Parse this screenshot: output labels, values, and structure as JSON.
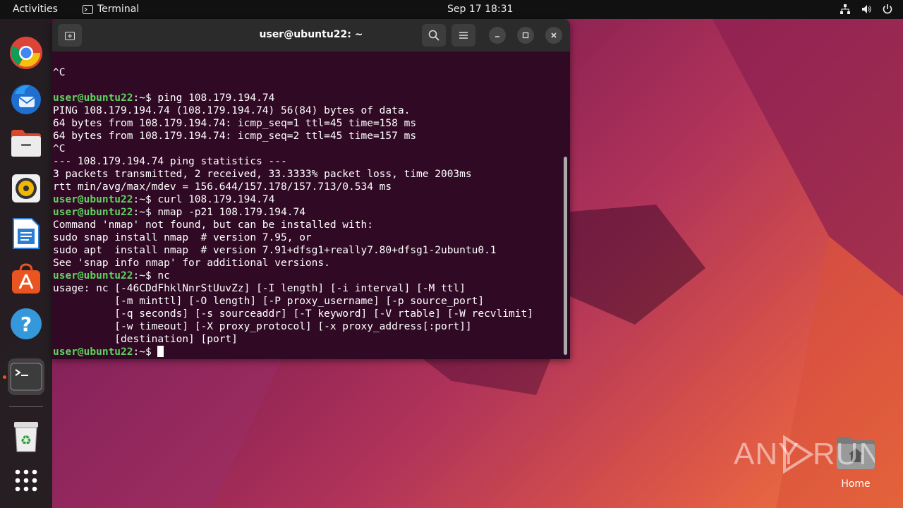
{
  "topbar": {
    "activities": "Activities",
    "app_name": "Terminal",
    "clock": "Sep 17  18:31"
  },
  "dock": {
    "items": [
      "chrome-icon",
      "thunderbird-icon",
      "files-icon",
      "rhythmbox-icon",
      "libreoffice-writer-icon",
      "app-center-icon",
      "help-icon",
      "terminal-icon",
      "trash-icon",
      "show-apps-icon"
    ]
  },
  "terminal": {
    "title": "user@ubuntu22: ~",
    "prompt_user": "user@ubuntu22",
    "prompt_suffix": ":~$",
    "lines": [
      {
        "type": "out",
        "text": "^C"
      },
      {
        "type": "out",
        "text": ""
      },
      {
        "type": "cmd",
        "text": " ping 108.179.194.74"
      },
      {
        "type": "out",
        "text": "PING 108.179.194.74 (108.179.194.74) 56(84) bytes of data."
      },
      {
        "type": "out",
        "text": "64 bytes from 108.179.194.74: icmp_seq=1 ttl=45 time=158 ms"
      },
      {
        "type": "out",
        "text": "64 bytes from 108.179.194.74: icmp_seq=2 ttl=45 time=157 ms"
      },
      {
        "type": "out",
        "text": "^C"
      },
      {
        "type": "out",
        "text": "--- 108.179.194.74 ping statistics ---"
      },
      {
        "type": "out",
        "text": "3 packets transmitted, 2 received, 33.3333% packet loss, time 2003ms"
      },
      {
        "type": "out",
        "text": "rtt min/avg/max/mdev = 156.644/157.178/157.713/0.534 ms"
      },
      {
        "type": "cmd",
        "text": " curl 108.179.194.74"
      },
      {
        "type": "cmd",
        "text": " nmap -p21 108.179.194.74"
      },
      {
        "type": "out",
        "text": "Command 'nmap' not found, but can be installed with:"
      },
      {
        "type": "out",
        "text": "sudo snap install nmap  # version 7.95, or"
      },
      {
        "type": "out",
        "text": "sudo apt  install nmap  # version 7.91+dfsg1+really7.80+dfsg1-2ubuntu0.1"
      },
      {
        "type": "out",
        "text": "See 'snap info nmap' for additional versions."
      },
      {
        "type": "cmd",
        "text": " nc"
      },
      {
        "type": "out",
        "text": "usage: nc [-46CDdFhklNnrStUuvZz] [-I length] [-i interval] [-M ttl]"
      },
      {
        "type": "out",
        "text": "          [-m minttl] [-O length] [-P proxy_username] [-p source_port]"
      },
      {
        "type": "out",
        "text": "          [-q seconds] [-s sourceaddr] [-T keyword] [-V rtable] [-W recvlimit]"
      },
      {
        "type": "out",
        "text": "          [-w timeout] [-X proxy_protocol] [-x proxy_address[:port]]"
      },
      {
        "type": "out",
        "text": "          [destination] [port]"
      },
      {
        "type": "cmd",
        "text": " "
      }
    ]
  },
  "desktop": {
    "home_label": "Home",
    "watermark": "ANY RUN"
  }
}
